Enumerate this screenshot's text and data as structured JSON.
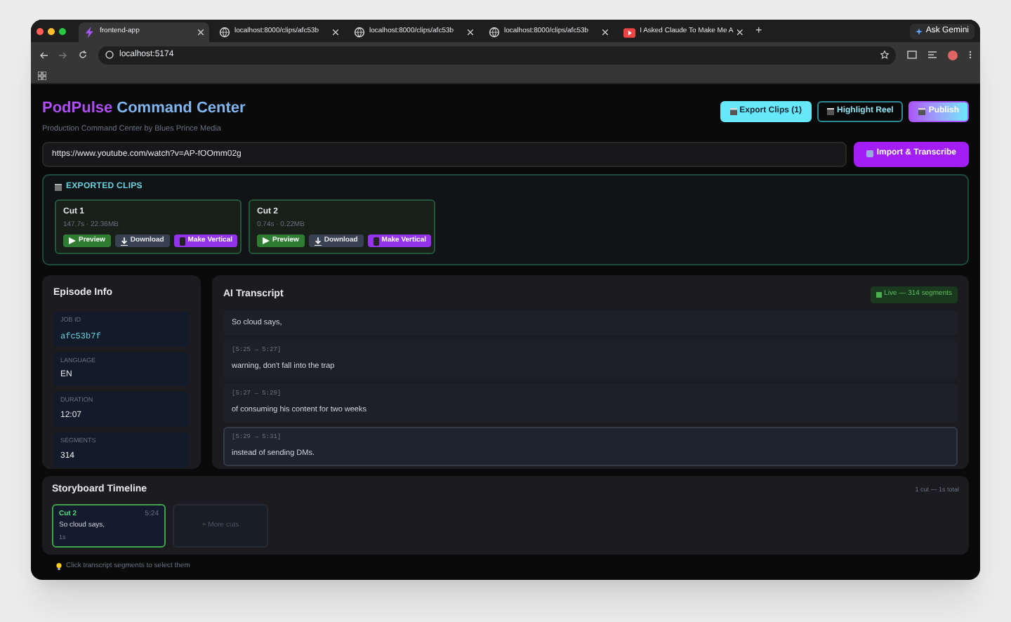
{
  "browser": {
    "tabs": [
      {
        "title": "frontend-app",
        "kind": "app",
        "selected": true
      },
      {
        "title": "localhost:8000/clips/afc53b",
        "kind": "globe",
        "selected": false
      },
      {
        "title": "localhost:8000/clips/afc53b",
        "kind": "globe",
        "selected": false
      },
      {
        "title": "localhost:8000/clips/afc53b",
        "kind": "globe",
        "selected": false
      },
      {
        "title": "I Asked Claude To Make Me A",
        "kind": "video",
        "selected": false
      }
    ],
    "new_tab": "+",
    "ask": "Ask Gemini",
    "address": "localhost:5174"
  },
  "header": {
    "brand": "PodPulse",
    "title": "Command Center",
    "subtitle": "Production Command Center by Blues Prince Media",
    "actions": [
      {
        "label": "Export Clips (1)",
        "kind": "export"
      },
      {
        "label": "Highlight Reel",
        "kind": "outline"
      },
      {
        "label": "Publish",
        "kind": "publish"
      }
    ]
  },
  "url": {
    "value": "https://www.youtube.com/watch?v=AP-fOOmm02g",
    "button": "Import & Transcribe"
  },
  "exported": {
    "title": "EXPORTED CLIPS",
    "clips": [
      {
        "name": "Cut 1",
        "meta": "147.7s · 22.36MB",
        "buttons": [
          {
            "label": "Preview",
            "kind": "preview"
          },
          {
            "label": "Download",
            "kind": "download"
          },
          {
            "label": "Make Vertical",
            "kind": "vertical"
          }
        ]
      },
      {
        "name": "Cut 2",
        "meta": "0.74s · 0.22MB",
        "buttons": [
          {
            "label": "Preview",
            "kind": "preview"
          },
          {
            "label": "Download",
            "kind": "download"
          },
          {
            "label": "Make Vertical",
            "kind": "vertical"
          }
        ]
      }
    ]
  },
  "episode": {
    "title": "Episode Info",
    "fields": [
      {
        "label": "JOB ID",
        "value": "afc53b7f",
        "kind": "mono"
      },
      {
        "label": "LANGUAGE",
        "value": "EN",
        "kind": "plain"
      },
      {
        "label": "DURATION",
        "value": "12:07",
        "kind": "plain"
      },
      {
        "label": "SEGMENTS",
        "value": "314",
        "kind": "plain"
      }
    ]
  },
  "transcript": {
    "title": "AI Transcript",
    "badge": "Live — 314 segments",
    "segments": [
      {
        "text": "So cloud says,",
        "selected": false
      },
      {
        "time": "[5:25 → 5:27]",
        "text": "warning, don't fall into the trap",
        "selected": false
      },
      {
        "time": "[5:27 → 5:29]",
        "text": "of consuming his content for two weeks",
        "selected": false
      },
      {
        "time": "[5:29 → 5:31]",
        "text": "instead of sending DMs.",
        "selected": true
      }
    ]
  },
  "storyboard": {
    "title": "Storyboard Timeline",
    "summary": "1 cut — 1s total",
    "cuts": [
      {
        "name": "Cut 2",
        "time": "5:24",
        "text": "So cloud says,",
        "duration": "1s",
        "selected": true
      }
    ],
    "more": "+ More cuts"
  },
  "hint": "Click transcript segments to select them"
}
